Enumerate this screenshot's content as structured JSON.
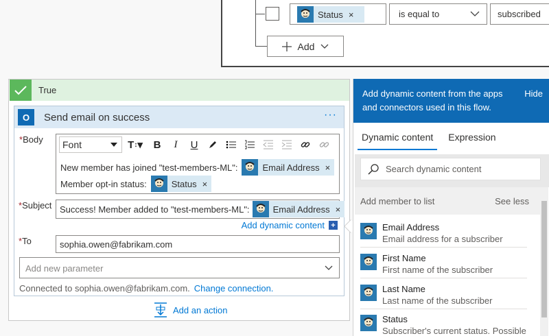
{
  "condition": {
    "field_token": "Status",
    "operator": "is equal to",
    "value": "subscribed",
    "add_label": "Add"
  },
  "branch": {
    "label": "True"
  },
  "action": {
    "title": "Send email on success",
    "more": "···",
    "body_label": "Body",
    "font_label": "Font",
    "body_line1_text": "New member has joined \"test-members-ML\":",
    "body_line1_token": "Email Address",
    "body_line2_text": "Member opt-in status:",
    "body_line2_token": "Status",
    "subject_label": "Subject",
    "subject_text": "Success! Member added to \"test-members-ML\":",
    "subject_token": "Email Address",
    "add_dynamic": "Add dynamic content",
    "to_label": "To",
    "to_value": "sophia.owen@fabrikam.com",
    "param_placeholder": "Add new parameter",
    "connected_text": "Connected to sophia.owen@fabrikam.com.",
    "change_connection": "Change connection."
  },
  "add_action_label": "Add an action",
  "panel": {
    "header_text": "Add dynamic content from the apps and connectors used in this flow.",
    "hide_label": "Hide",
    "tabs": [
      "Dynamic content",
      "Expression"
    ],
    "search_placeholder": "Search dynamic content",
    "section_title": "Add member to list",
    "see_less": "See less",
    "items": [
      {
        "name": "Email Address",
        "desc": "Email address for a subscriber"
      },
      {
        "name": "First Name",
        "desc": "First name of the subscriber"
      },
      {
        "name": "Last Name",
        "desc": "Last name of the subscriber"
      },
      {
        "name": "Status",
        "desc": "Subscriber's current status. Possible..."
      }
    ]
  }
}
